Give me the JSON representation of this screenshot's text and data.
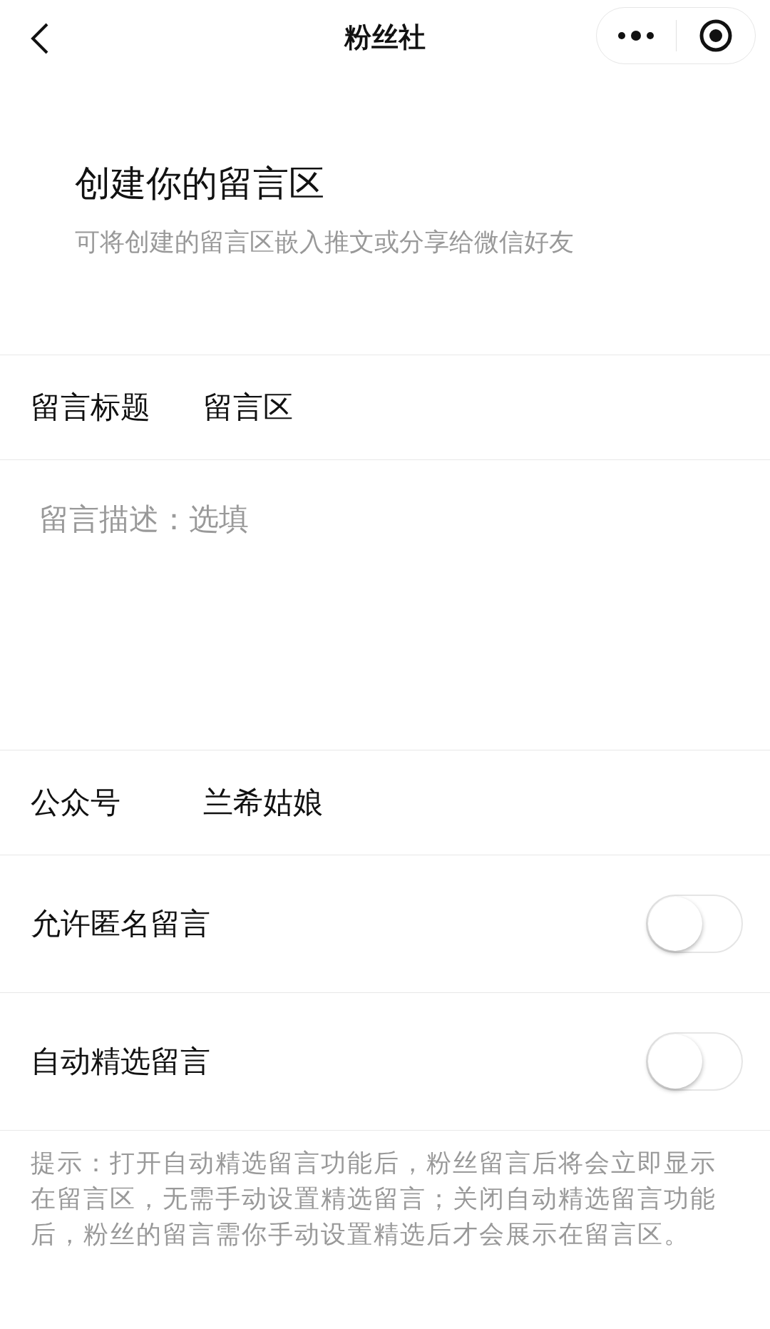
{
  "nav": {
    "title": "粉丝社"
  },
  "header": {
    "title": "创建你的留言区",
    "subtitle": "可将创建的留言区嵌入推文或分享给微信好友"
  },
  "title_row": {
    "label": "留言标题",
    "value": "留言区"
  },
  "description": {
    "placeholder": "留言描述：选填"
  },
  "account_row": {
    "label": "公众号",
    "value": "兰希姑娘"
  },
  "switches": [
    {
      "label": "允许匿名留言",
      "on": false
    },
    {
      "label": "自动精选留言",
      "on": false
    }
  ],
  "hint": "提示：打开自动精选留言功能后，粉丝留言后将会立即显示在留言区，无需手动设置精选留言；关闭自动精选留言功能后，粉丝的留言需你手动设置精选后才会展示在留言区。"
}
